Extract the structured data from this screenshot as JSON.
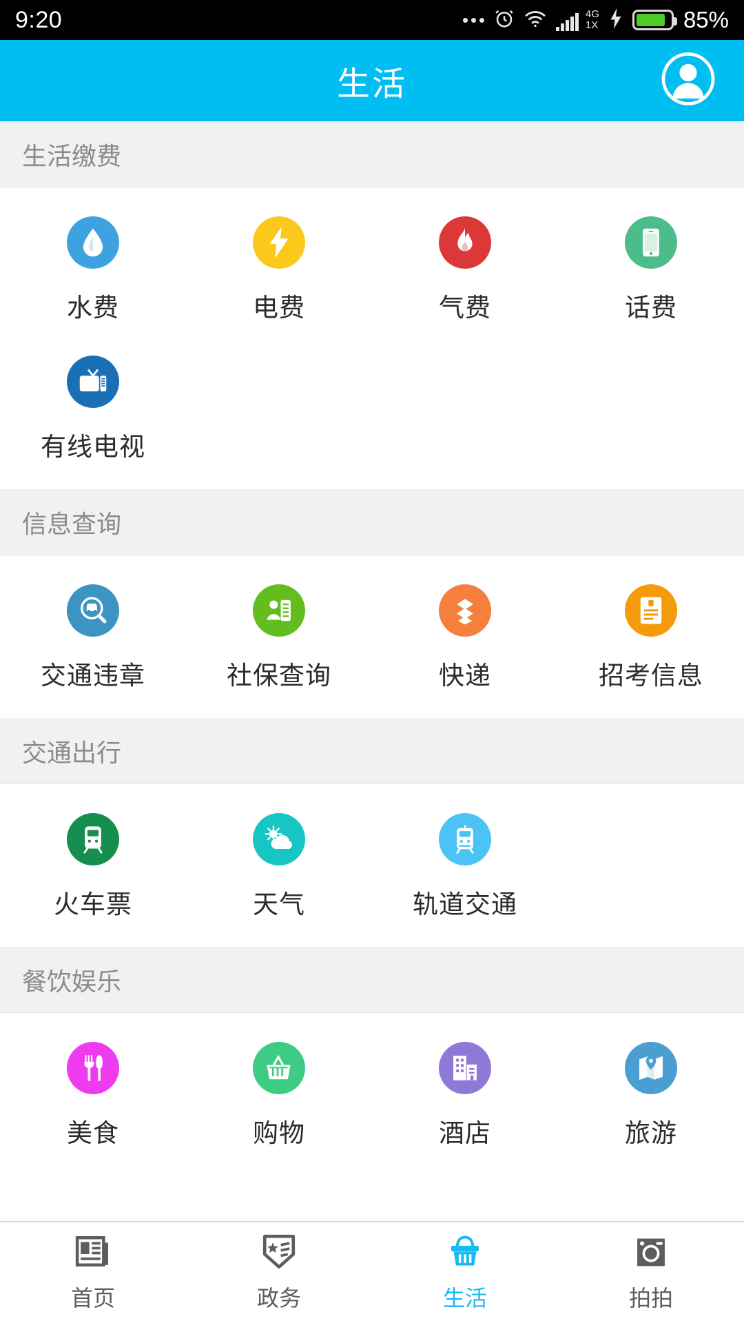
{
  "status_bar": {
    "time": "9:20",
    "battery_percent": "85%",
    "network_primary": "4G",
    "network_secondary": "1X",
    "icons": [
      "more-dots-icon",
      "alarm-clock-icon",
      "wifi-icon",
      "signal-bars-icon",
      "charging-bolt-icon",
      "battery-icon"
    ]
  },
  "header": {
    "title": "生活",
    "avatar_icon": "user-avatar-icon",
    "background_color": "#00bdf2"
  },
  "sections": [
    {
      "title": "生活缴费",
      "items": [
        {
          "label": "水费",
          "icon": "water-drop-icon",
          "color": "#3fa2e0"
        },
        {
          "label": "电费",
          "icon": "lightning-bolt-icon",
          "color": "#fbc91c"
        },
        {
          "label": "气费",
          "icon": "flame-icon",
          "color": "#dc3838"
        },
        {
          "label": "话费",
          "icon": "mobile-phone-icon",
          "color": "#4cbd8a"
        },
        {
          "label": "有线电视",
          "icon": "television-icon",
          "color": "#1a6fb5"
        }
      ]
    },
    {
      "title": "信息查询",
      "items": [
        {
          "label": "交通违章",
          "icon": "car-search-icon",
          "color": "#3d93c2"
        },
        {
          "label": "社保查询",
          "icon": "person-card-icon",
          "color": "#64bd1e"
        },
        {
          "label": "快递",
          "icon": "parcel-stack-icon",
          "color": "#f5803e"
        },
        {
          "label": "招考信息",
          "icon": "id-document-icon",
          "color": "#f59b0b"
        }
      ]
    },
    {
      "title": "交通出行",
      "items": [
        {
          "label": "火车票",
          "icon": "train-icon",
          "color": "#168e4f"
        },
        {
          "label": "天气",
          "icon": "sun-cloud-icon",
          "color": "#17c5c5"
        },
        {
          "label": "轨道交通",
          "icon": "tram-icon",
          "color": "#4cc3f5"
        }
      ]
    },
    {
      "title": "餐饮娱乐",
      "items": [
        {
          "label": "美食",
          "icon": "fork-knife-icon",
          "color": "#ef3bef"
        },
        {
          "label": "购物",
          "icon": "shopping-basket-icon",
          "color": "#3ecb84"
        },
        {
          "label": "酒店",
          "icon": "building-icon",
          "color": "#8e7ad6"
        },
        {
          "label": "旅游",
          "icon": "map-pin-icon",
          "color": "#4a9ed1"
        }
      ]
    }
  ],
  "tabbar": {
    "active_color": "#17b9ef",
    "inactive_color": "#5d5d5d",
    "tabs": [
      {
        "label": "首页",
        "icon": "newspaper-icon",
        "active": false
      },
      {
        "label": "政务",
        "icon": "shield-badge-icon",
        "active": false
      },
      {
        "label": "生活",
        "icon": "basket-icon",
        "active": true
      },
      {
        "label": "拍拍",
        "icon": "camera-icon",
        "active": false
      }
    ]
  }
}
